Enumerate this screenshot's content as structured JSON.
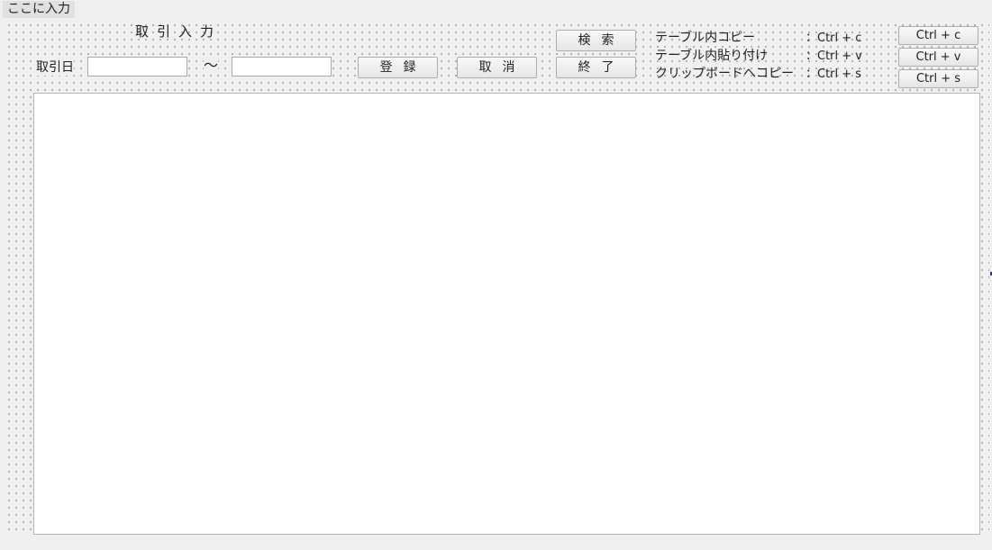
{
  "menubar": {
    "item": "ここに入力"
  },
  "form": {
    "title": "取引入力",
    "date_label": "取引日",
    "date_from_value": "",
    "date_to_value": "",
    "range_separator": "〜",
    "buttons": {
      "register": "登録",
      "cancel": "取消",
      "search": "検索",
      "exit": "終了"
    },
    "shortcuts": [
      {
        "description": "テーブル内コピー",
        "keys": "：Ctrl + c",
        "button": "Ctrl + c"
      },
      {
        "description": "テーブル内貼り付け",
        "keys": "：Ctrl + v",
        "button": "Ctrl + v"
      },
      {
        "description": "クリップボードへコピー",
        "keys": "：Ctrl + s",
        "button": "Ctrl + s"
      }
    ]
  }
}
